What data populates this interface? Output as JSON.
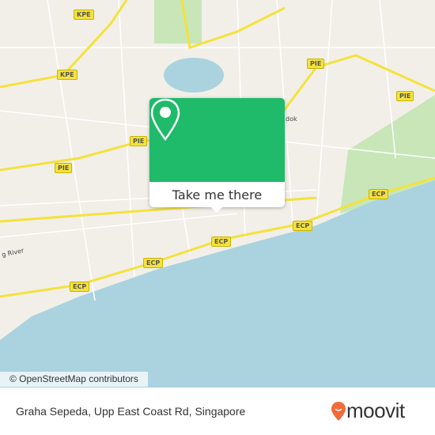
{
  "map": {
    "road_labels": [
      {
        "text": "KPE",
        "pos": "kpe1"
      },
      {
        "text": "KPE",
        "pos": "kpe2"
      },
      {
        "text": "PIE",
        "pos": "pie1"
      },
      {
        "text": "PIE",
        "pos": "pie2"
      },
      {
        "text": "PIE",
        "pos": "pie3"
      },
      {
        "text": "PIE",
        "pos": "pie4"
      },
      {
        "text": "ECP",
        "pos": "ecp1"
      },
      {
        "text": "ECP",
        "pos": "ecp2"
      },
      {
        "text": "ECP",
        "pos": "ecp3"
      },
      {
        "text": "ECP",
        "pos": "ecp4"
      },
      {
        "text": "ECP",
        "pos": "ecp5"
      }
    ],
    "place_labels": [
      "g River",
      "dok"
    ],
    "attribution": "© OpenStreetMap contributors",
    "colors": {
      "land": "#f2efe9",
      "sea": "#aad3df",
      "highway": "#f4e23c",
      "park": "#c8e6b8"
    }
  },
  "popup": {
    "button_label": "Take me there",
    "color": "#1fba6a",
    "icon": "map-pin-icon"
  },
  "footer": {
    "place_name": "Graha Sepeda, Upp East Coast Rd, Singapore",
    "brand": "moovit",
    "brand_color": "#f26b3a"
  }
}
